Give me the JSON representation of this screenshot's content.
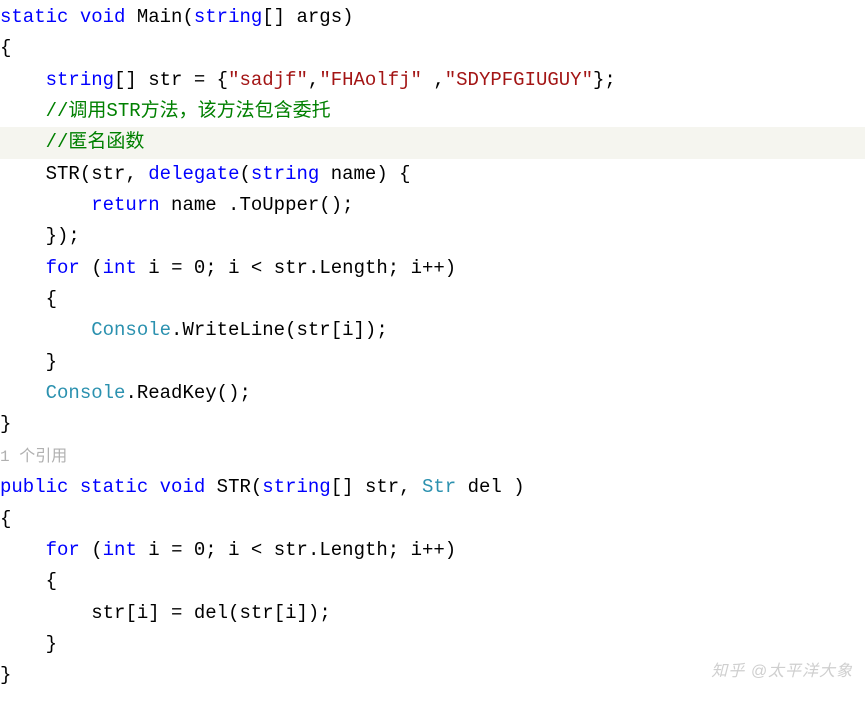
{
  "keywords": {
    "static": "static",
    "void": "void",
    "string": "string",
    "delegate": "delegate",
    "return": "return",
    "for": "for",
    "int": "int",
    "public": "public"
  },
  "identifiers": {
    "Main": "Main",
    "args": "args",
    "str": "str",
    "STR": "STR",
    "name": "name",
    "ToUpper": "ToUpper",
    "i": "i",
    "Length": "Length",
    "Console": "Console",
    "WriteLine": "WriteLine",
    "ReadKey": "ReadKey",
    "Str": "Str",
    "del": "del"
  },
  "strings": {
    "s1": "\"sadjf\"",
    "s2": "\"FHAolfj\"",
    "s3": "\"SDYPFGIUGUY\""
  },
  "comments": {
    "c1": "//调用STR方法，该方法包含委托",
    "c2": "//匿名函数"
  },
  "numbers": {
    "zero": "0"
  },
  "punct": {
    "lparen": "(",
    "rparen": ")",
    "lbrace": "{",
    "rbrace": "}",
    "lbracket": "[",
    "rbracket": "]",
    "semi": ";",
    "comma": ",",
    "dot": ".",
    "eq": "=",
    "lt": "<",
    "pp": "++",
    "space": " "
  },
  "refcount": "1 个引用",
  "watermark": "知乎 @太平洋大象"
}
